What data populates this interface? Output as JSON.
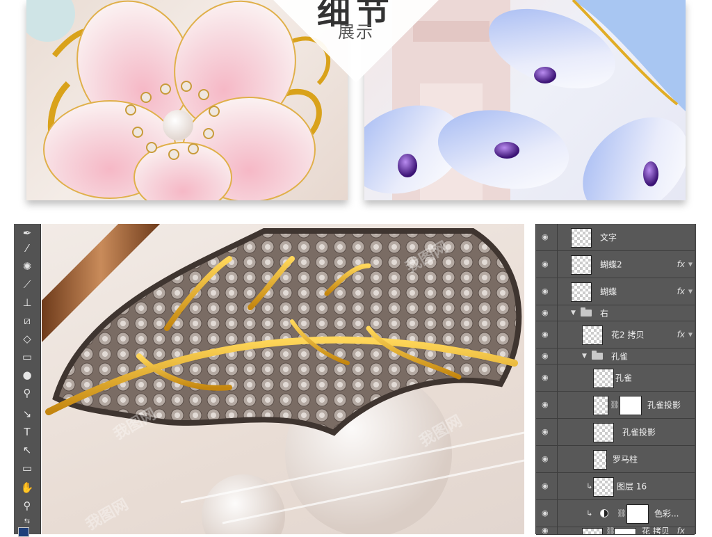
{
  "showcase": {
    "title": "细节",
    "subtitle": "展示"
  },
  "watermark": "我图网",
  "toolbar": {
    "tools": [
      {
        "icon": "pen-tip-icon"
      },
      {
        "icon": "eyedropper-icon"
      },
      {
        "icon": "healing-brush-icon"
      },
      {
        "icon": "brush-icon"
      },
      {
        "icon": "clone-stamp-icon"
      },
      {
        "icon": "history-brush-icon"
      },
      {
        "icon": "eraser-icon"
      },
      {
        "icon": "gradient-icon"
      },
      {
        "icon": "blur-icon"
      },
      {
        "icon": "dodge-icon"
      },
      {
        "icon": "pen-icon"
      },
      {
        "icon": "type-icon"
      },
      {
        "icon": "path-select-icon"
      },
      {
        "icon": "rectangle-icon"
      },
      {
        "icon": "hand-icon"
      },
      {
        "icon": "zoom-icon"
      }
    ],
    "foreground_color": "#1f3f7a",
    "background_color": "#ffffff"
  },
  "layers": [
    {
      "name": "文字",
      "fx": false
    },
    {
      "name": "蝴蝶2",
      "fx": true
    },
    {
      "name": "蝴蝶",
      "fx": true
    },
    {
      "name": "右",
      "group": true
    },
    {
      "name": "花2 拷贝",
      "fx": true
    },
    {
      "name": "孔雀",
      "group": true
    },
    {
      "name": "孔雀",
      "fx": false
    },
    {
      "name": "孔雀投影",
      "fx": false,
      "mask": true
    },
    {
      "name": "孔雀投影",
      "fx": false
    },
    {
      "name": "罗马柱",
      "fx": false
    },
    {
      "name": "图层 16",
      "fx": false,
      "clipped": true
    },
    {
      "name": "色彩...",
      "fx": false,
      "adjustment": true
    },
    {
      "name": "花 拷贝",
      "fx": true,
      "mask": true
    }
  ],
  "layers_labels": {
    "fx": "fx"
  }
}
